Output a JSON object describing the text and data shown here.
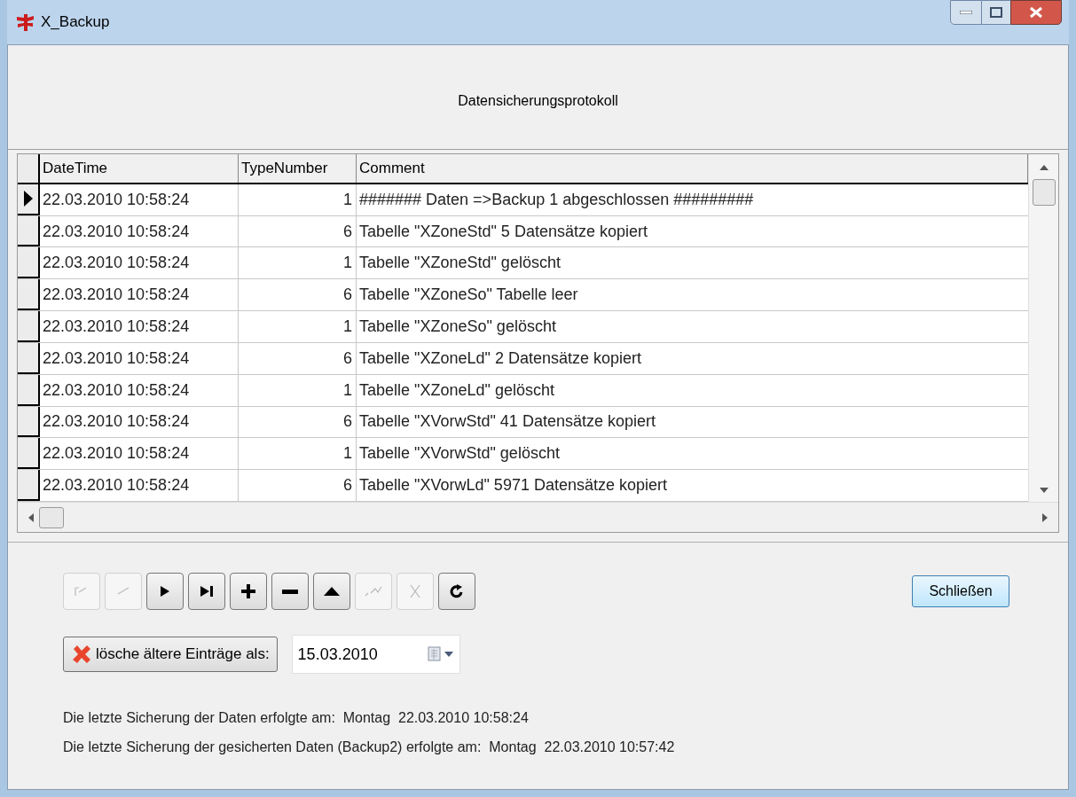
{
  "window": {
    "title": "X_Backup"
  },
  "header": "Datensicherungsprotokoll",
  "table": {
    "columns": [
      "DateTime",
      "TypeNumber",
      "Comment"
    ],
    "rows": [
      {
        "datetime": "22.03.2010 10:58:24",
        "type": "1",
        "comment": "####### Daten =>Backup 1 abgeschlossen #########",
        "selected": true
      },
      {
        "datetime": "22.03.2010 10:58:24",
        "type": "6",
        "comment": "Tabelle \"XZoneStd\" 5 Datensätze kopiert",
        "selected": false
      },
      {
        "datetime": "22.03.2010 10:58:24",
        "type": "1",
        "comment": "Tabelle \"XZoneStd\" gelöscht",
        "selected": false
      },
      {
        "datetime": "22.03.2010 10:58:24",
        "type": "6",
        "comment": "Tabelle \"XZoneSo\" Tabelle leer",
        "selected": false
      },
      {
        "datetime": "22.03.2010 10:58:24",
        "type": "1",
        "comment": "Tabelle \"XZoneSo\" gelöscht",
        "selected": false
      },
      {
        "datetime": "22.03.2010 10:58:24",
        "type": "6",
        "comment": "Tabelle \"XZoneLd\" 2 Datensätze kopiert",
        "selected": false
      },
      {
        "datetime": "22.03.2010 10:58:24",
        "type": "1",
        "comment": "Tabelle \"XZoneLd\" gelöscht",
        "selected": false
      },
      {
        "datetime": "22.03.2010 10:58:24",
        "type": "6",
        "comment": "Tabelle \"XVorwStd\" 41 Datensätze kopiert",
        "selected": false
      },
      {
        "datetime": "22.03.2010 10:58:24",
        "type": "1",
        "comment": "Tabelle \"XVorwStd\" gelöscht",
        "selected": false
      },
      {
        "datetime": "22.03.2010 10:58:24",
        "type": "6",
        "comment": "Tabelle \"XVorwLd\" 5971 Datensätze kopiert",
        "selected": false
      }
    ]
  },
  "navigator": [
    {
      "kind": "first",
      "disabled": true
    },
    {
      "kind": "prior",
      "disabled": true
    },
    {
      "kind": "next",
      "disabled": false
    },
    {
      "kind": "last",
      "disabled": false
    },
    {
      "kind": "insert",
      "disabled": false
    },
    {
      "kind": "delete",
      "disabled": false
    },
    {
      "kind": "edit",
      "disabled": false
    },
    {
      "kind": "post",
      "disabled": true
    },
    {
      "kind": "cancel",
      "disabled": true
    },
    {
      "kind": "refresh",
      "disabled": false
    }
  ],
  "close_button": "Schließen",
  "delete_button": "lösche ältere Einträge als:",
  "date_field": {
    "value": "15.03.2010"
  },
  "status_lines": [
    "Die letzte Sicherung der Daten erfolgte am:  Montag  22.03.2010 10:58:24",
    "Die letzte Sicherung der gesicherten Daten (Backup2) erfolgte am:  Montag  22.03.2010 10:57:42"
  ]
}
